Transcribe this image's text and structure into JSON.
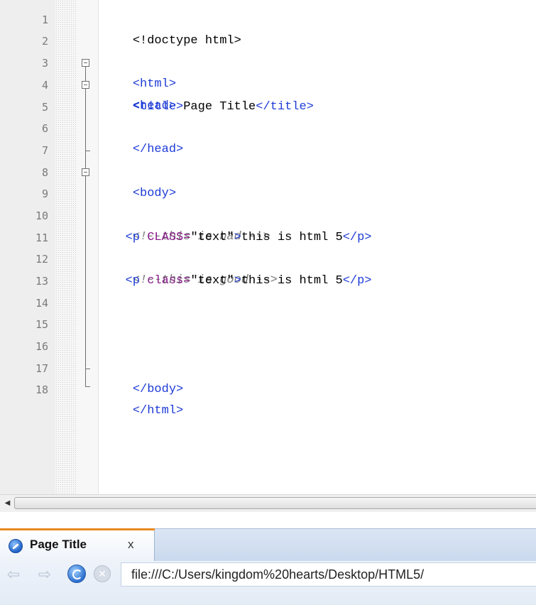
{
  "editor": {
    "line_numbers": [
      "1",
      "2",
      "3",
      "4",
      "5",
      "6",
      "7",
      "8",
      "9",
      "10",
      "11",
      "12",
      "13",
      "14",
      "15",
      "16",
      "17",
      "18"
    ],
    "lines": {
      "l1": {
        "doctype": "<!doctype html>"
      },
      "l3": {
        "tag": "<html>"
      },
      "l4": {
        "tag": "<head>"
      },
      "l5": {
        "indent": "    ",
        "open": "<title>",
        "text": "Page Title",
        "close": "</title>"
      },
      "l6": {
        "tag": "</head>"
      },
      "l8": {
        "tag": "<body>"
      },
      "l10": {
        "comment": "<!--this is bad -->"
      },
      "l11": {
        "indent": "   ",
        "open": "<p",
        "attr": " CLASS=",
        "value": "\"text\"",
        "gt": ">",
        "text": "this is html 5",
        "close": "</p>"
      },
      "l12": {
        "comment": "<!--this is good -->"
      },
      "l13": {
        "indent": "   ",
        "open": "<p",
        "attr": " class=",
        "value": "\"text\"",
        "gt": ">",
        "text": "this is html 5",
        "close": "</p>"
      },
      "l16": {
        "tag": "</body>"
      },
      "l17": {
        "tag": "</html>"
      }
    }
  },
  "scrollbar": {
    "left_arrow": "◀"
  },
  "browser": {
    "tab": {
      "title": "Page Title",
      "close": "x",
      "icon": "browser-globe-icon"
    },
    "nav": {
      "back": "⇦",
      "forward": "⇨",
      "stop": "✕"
    },
    "url": "file:///C:/Users/kingdom%20hearts/Desktop/HTML5/",
    "colors": {
      "tab_accent": "#e8891f",
      "tag": "#1d3bd6",
      "attr": "#8a1a8a",
      "comment": "#7a7a7a"
    }
  }
}
